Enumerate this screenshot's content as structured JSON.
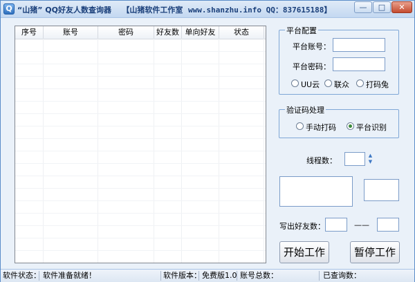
{
  "titlebar": {
    "title_part1": "“山猪” QQ好友人数查询器",
    "title_part2": "【山猪软件工作室",
    "title_part3": "www.shanzhu.info QQ：837615188】",
    "app_icon": "Q",
    "minimize": "—",
    "maximize": "□",
    "close": "✕"
  },
  "table": {
    "columns": [
      "序号",
      "账号",
      "密码",
      "好友数",
      "单向好友",
      "状态"
    ],
    "rows": []
  },
  "platform_config": {
    "title": "平台配置",
    "account_label": "平台账号：",
    "account_value": "",
    "password_label": "平台密码：",
    "password_value": "",
    "options": [
      "UU云",
      "联众",
      "打码兔"
    ],
    "selected": null
  },
  "captcha": {
    "title": "验证码处理",
    "options": [
      "手动打码",
      "平台识别"
    ],
    "selected": "平台识别"
  },
  "threads": {
    "label": "线程数：",
    "value": "",
    "spin_up": "▲",
    "spin_down": "▼"
  },
  "export": {
    "label": "写出好友数：",
    "from": "",
    "separator": "——",
    "to": ""
  },
  "buttons": {
    "start": "开始工作",
    "pause": "暂停工作"
  },
  "statusbar": {
    "status_label": "软件状态：",
    "status_value": "软件准备就绪！",
    "version_label": "软件版本：",
    "version_value": "免费版1.0",
    "total_label": "账号总数：",
    "queried_label": "已查询数："
  }
}
